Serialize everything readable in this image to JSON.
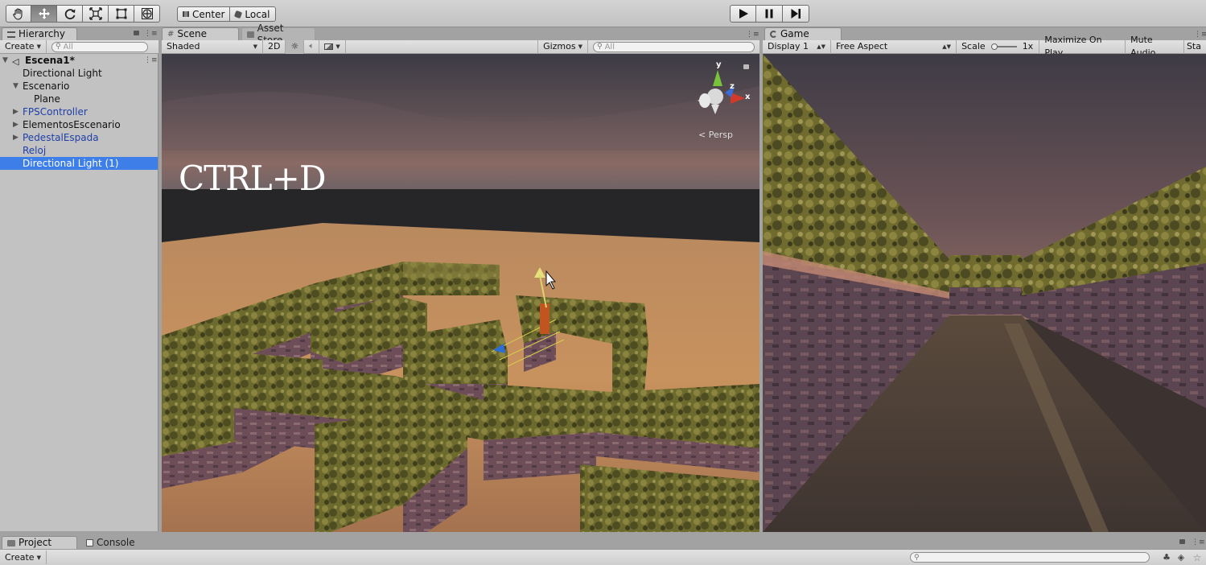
{
  "toolbar": {
    "tools": [
      "hand-tool",
      "move-tool",
      "rotate-tool",
      "scale-tool",
      "rect-tool",
      "transform-tool"
    ],
    "pivot_label": "Center",
    "space_label": "Local",
    "playback": [
      "play",
      "pause",
      "step"
    ]
  },
  "hierarchy": {
    "tab_label": "Hierarchy",
    "create_label": "Create",
    "search_placeholder": "All",
    "scene_name": "Escena1*",
    "items": [
      {
        "label": "Directional Light"
      },
      {
        "label": "Escenario"
      },
      {
        "label": "Plane"
      },
      {
        "label": "FPSController"
      },
      {
        "label": "ElementosEscenario"
      },
      {
        "label": "PedestalEspada"
      },
      {
        "label": "Reloj"
      },
      {
        "label": "Directional Light (1)"
      }
    ]
  },
  "scene": {
    "tab_label": "Scene",
    "asset_store_label": "Asset Store",
    "shading_mode": "Shaded",
    "mode_2d": "2D",
    "gizmos_label": "Gizmos",
    "search_placeholder": "All",
    "overlay_text": "CTRL+D",
    "persp_label": "< Persp",
    "axis_labels": {
      "y": "y",
      "x": "x",
      "z": "z"
    }
  },
  "game": {
    "tab_label": "Game",
    "display_label": "Display 1",
    "aspect_label": "Free Aspect",
    "scale_label": "Scale",
    "scale_value": "1x",
    "maximize_label": "Maximize On Play",
    "mute_label": "Mute Audio",
    "stats_label": "Sta"
  },
  "bottom": {
    "project_label": "Project",
    "console_label": "Console",
    "create_label": "Create"
  },
  "colors": {
    "selection": "#3d7ee9",
    "prefab_blue": "#1f3fa8",
    "sand": "#c58d5c",
    "hedge": "#6e6a2c",
    "stone": "#7b5a62"
  }
}
